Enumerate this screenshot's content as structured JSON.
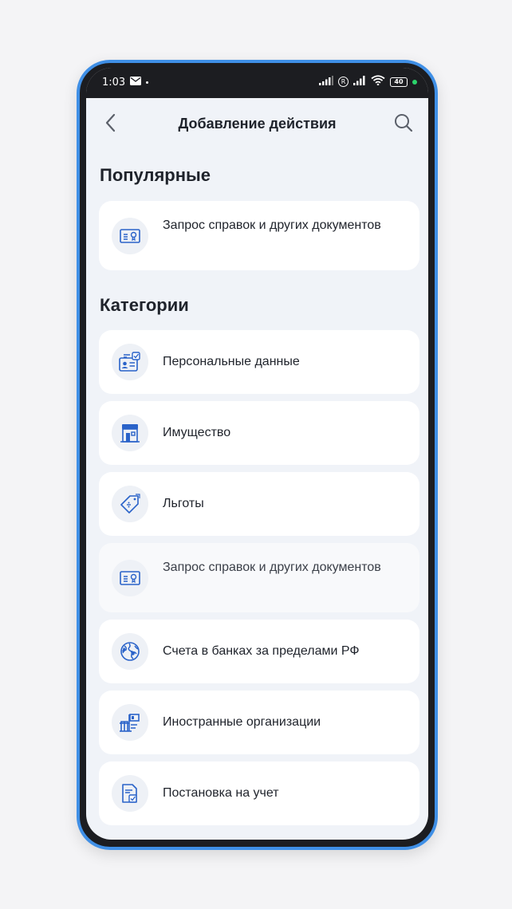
{
  "status_bar": {
    "time": "1:03",
    "registered_mark": "R",
    "battery_level": "40",
    "icons": [
      "mail-icon",
      "signal-icon",
      "wifi-icon",
      "battery-icon"
    ]
  },
  "header": {
    "title": "Добавление действия",
    "back_icon": "chevron-left-icon",
    "search_icon": "search-icon"
  },
  "popular": {
    "title": "Популярные",
    "items": [
      {
        "label": "Запрос справок и других документов",
        "icon": "certificate-icon"
      }
    ]
  },
  "categories": {
    "title": "Категории",
    "items": [
      {
        "label": "Персональные данные",
        "icon": "id-card-icon"
      },
      {
        "label": "Имущество",
        "icon": "house-icon"
      },
      {
        "label": "Льготы",
        "icon": "discount-tag-icon"
      },
      {
        "label": "Запрос справок и других документов",
        "icon": "certificate-icon"
      },
      {
        "label": "Счета в банках за пределами РФ",
        "icon": "globe-icon"
      },
      {
        "label": "Иностранные организации",
        "icon": "organization-flag-icon"
      },
      {
        "label": "Постановка на учет",
        "icon": "document-check-icon"
      }
    ]
  },
  "colors": {
    "accent": "#2a63c9",
    "frame": "#3f8fe6",
    "background": "#f0f3f8"
  }
}
